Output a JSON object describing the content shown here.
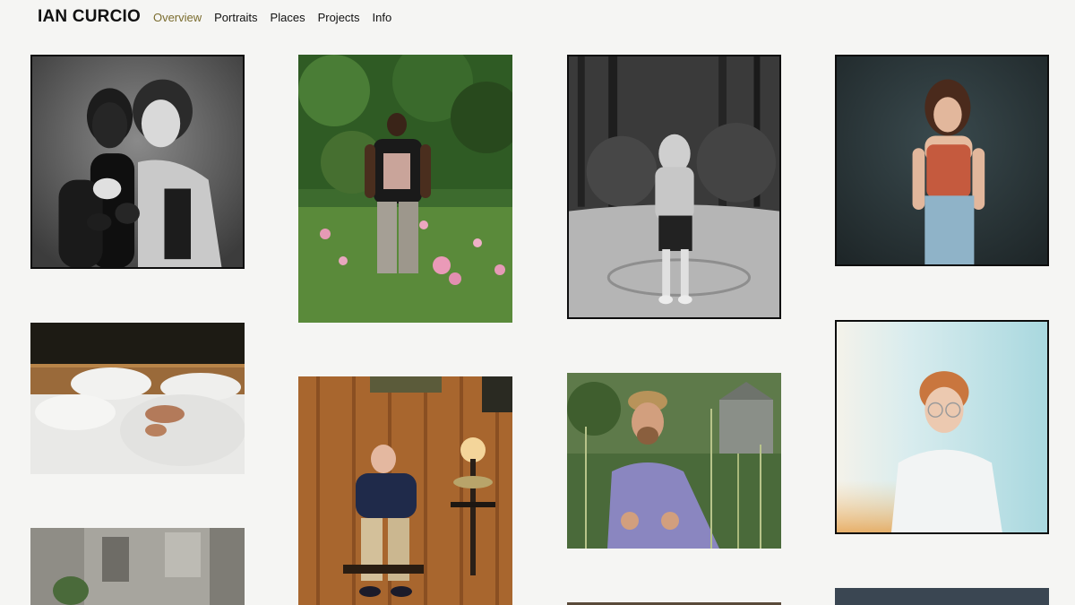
{
  "site": {
    "brand": "IAN CURCIO",
    "nav": [
      {
        "label": "Overview",
        "active": true
      },
      {
        "label": "Portraits",
        "active": false
      },
      {
        "label": "Places",
        "active": false
      },
      {
        "label": "Projects",
        "active": false
      },
      {
        "label": "Info",
        "active": false
      }
    ],
    "accent_color": "#7a6c2e"
  },
  "gallery": {
    "photos": [
      {
        "subject": "black-and-white portrait of two women embracing",
        "tone": "monochrome"
      },
      {
        "subject": "man in Nirvana t-shirt standing among pink flowers",
        "tone": "color"
      },
      {
        "subject": "child with hood over face standing on road among trees",
        "tone": "monochrome"
      },
      {
        "subject": "young woman in red tank top against dark backdrop",
        "tone": "color"
      },
      {
        "subject": "person sleeping in white bedding",
        "tone": "color"
      },
      {
        "subject": "older man seated in wood-paneled room holding fish",
        "tone": "color"
      },
      {
        "subject": "man in cap and glasses in tall grass",
        "tone": "color"
      },
      {
        "subject": "young man with glasses against pale blue background",
        "tone": "color"
      },
      {
        "subject": "weathered building facade with plant",
        "tone": "muted"
      },
      {
        "subject": "partially visible photo",
        "tone": "color"
      },
      {
        "subject": "partially visible photo",
        "tone": "color"
      }
    ]
  }
}
